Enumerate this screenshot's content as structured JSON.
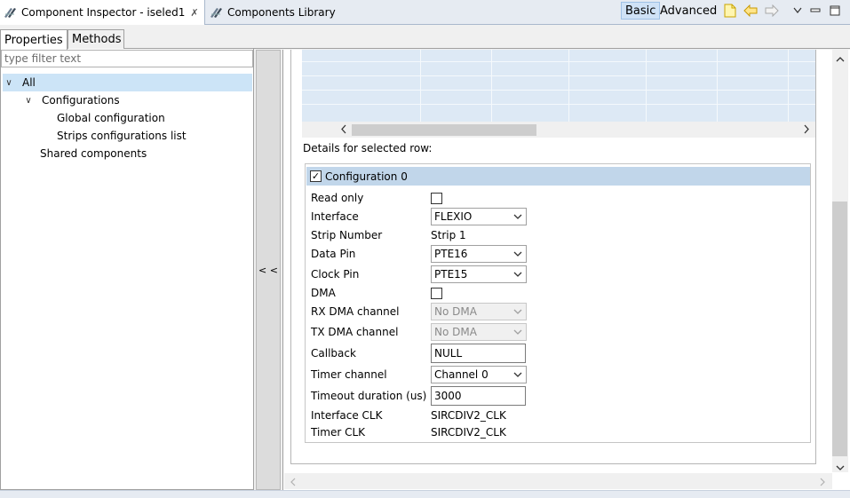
{
  "tabs": {
    "inspector": "Component Inspector - iseled1",
    "inspector_close": "✗",
    "library": "Components Library"
  },
  "toolbar": {
    "basic": "Basic",
    "advanced": "Advanced",
    "icons": [
      "new-note-icon",
      "back-arrow-icon",
      "forward-arrow-icon",
      "view-menu-icon",
      "minimize-icon",
      "maximize-icon"
    ]
  },
  "property_tabs": {
    "properties": "Properties",
    "methods": "Methods"
  },
  "filter": {
    "placeholder": "type filter text"
  },
  "tree": {
    "all": "All",
    "configurations": "Configurations",
    "global": "Global configuration",
    "strips": "Strips configurations list",
    "shared": "Shared components"
  },
  "collapse": "< <",
  "details": {
    "label": "Details for selected row:",
    "config_title": "Configuration 0",
    "config_checked": "✓",
    "fields": {
      "read_only": "Read only",
      "interface": "Interface",
      "interface_val": "FLEXIO",
      "strip_number": "Strip Number",
      "strip_number_val": "Strip 1",
      "data_pin": "Data Pin",
      "data_pin_val": "PTE16",
      "clock_pin": "Clock Pin",
      "clock_pin_val": "PTE15",
      "dma": "DMA",
      "rx_dma": "RX DMA channel",
      "rx_dma_val": "No DMA",
      "tx_dma": "TX DMA channel",
      "tx_dma_val": "No DMA",
      "callback": "Callback",
      "callback_val": "NULL",
      "timer_channel": "Timer channel",
      "timer_channel_val": "Channel 0",
      "timeout": "Timeout duration (us)",
      "timeout_val": "3000",
      "interface_clk": "Interface CLK",
      "interface_clk_val": "SIRCDIV2_CLK",
      "timer_clk": "Timer CLK",
      "timer_clk_val": "SIRCDIV2_CLK"
    }
  },
  "colors": {
    "accent": "#cce4f7",
    "header": "#c1d6ea",
    "grid": "#dde9f5"
  }
}
